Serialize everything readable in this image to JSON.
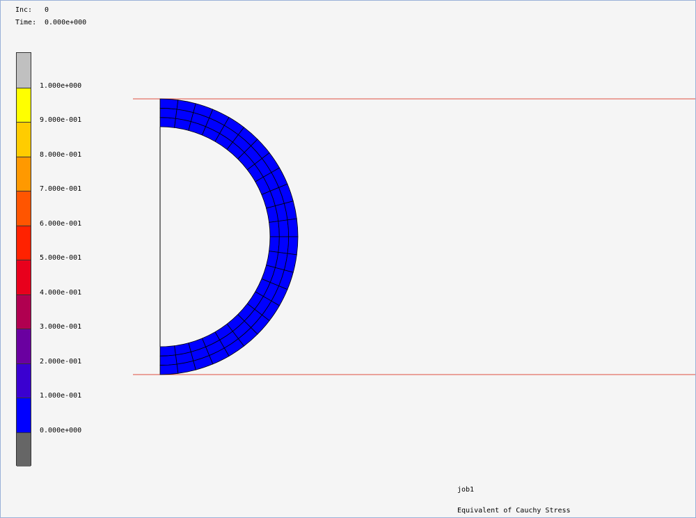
{
  "header": {
    "inc_label": "Inc:",
    "inc_value": "0",
    "time_label": "Time:",
    "time_value": "0.000e+000"
  },
  "legend": {
    "colors": [
      "#c0c0c0",
      "#ffff00",
      "#ffcc00",
      "#ff9900",
      "#ff5500",
      "#ff2200",
      "#e8001c",
      "#b00050",
      "#6a00a0",
      "#3a00d0",
      "#0000ff",
      "#666666"
    ],
    "labels": [
      "1.000e+000",
      "9.000e-001",
      "8.000e-001",
      "7.000e-001",
      "6.000e-001",
      "5.000e-001",
      "4.000e-001",
      "3.000e-001",
      "2.000e-001",
      "1.000e-001",
      "0.000e+000"
    ]
  },
  "model": {
    "mesh_color": "#0000ff",
    "boundary_line_color": "#e05040",
    "radial_divisions": 3,
    "circumferential_divisions": 24
  },
  "footer": {
    "job_name": "job1",
    "result_quantity": "Equivalent of Cauchy Stress"
  }
}
